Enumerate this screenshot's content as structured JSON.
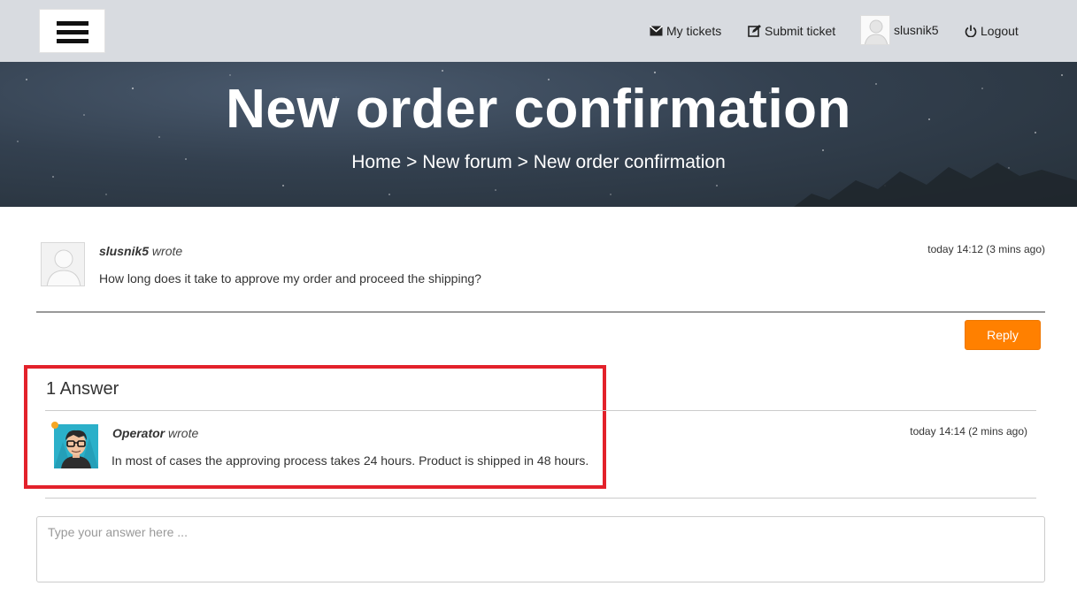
{
  "nav": {
    "my_tickets": "My tickets",
    "submit_ticket": "Submit ticket",
    "username": "slusnik5",
    "logout": "Logout",
    "icons": [
      "menu-icon",
      "envelope-icon",
      "edit-icon",
      "user-icon",
      "power-icon"
    ]
  },
  "hero": {
    "title": "New order confirmation",
    "breadcrumb": {
      "home": "Home",
      "separator": ">",
      "forum": "New forum",
      "current": "New order confirmation"
    }
  },
  "question": {
    "author": "slusnik5",
    "wrote": "wrote",
    "time": "today 14:12 (3 mins ago)",
    "text": "How long does it take to approve my order and proceed the shipping?"
  },
  "reply_button": "Reply",
  "answers": {
    "heading": "1 Answer",
    "items": [
      {
        "author": "Operator",
        "wrote": "wrote",
        "time": "today 14:14 (2 mins ago)",
        "text": "In most of cases the approving process takes 24 hours. Product is shipped in 48 hours."
      }
    ]
  },
  "answer_input": {
    "placeholder": "Type your answer here ...",
    "value": ""
  },
  "colors": {
    "accent": "#ff8000",
    "highlight": "#e3212b",
    "online": "#f5a623"
  }
}
